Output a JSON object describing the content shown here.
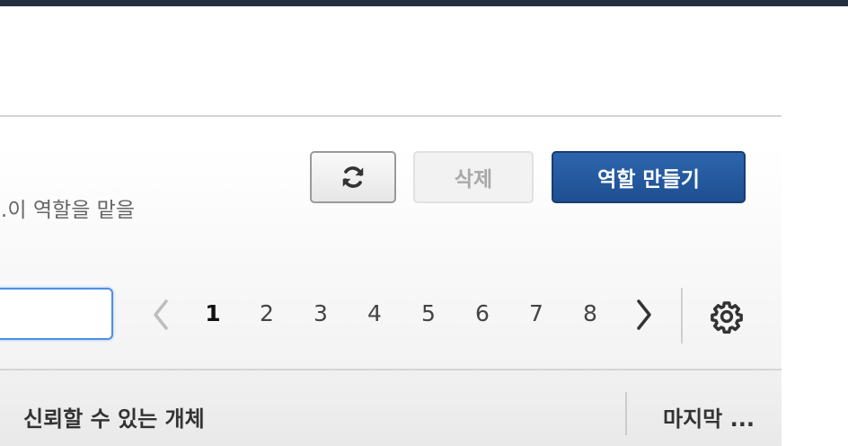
{
  "description": {
    "text": "…이 역할을 맡을"
  },
  "toolbar": {
    "refresh_icon": "refresh-icon",
    "delete_label": "삭제",
    "create_label": "역할 만들기"
  },
  "search": {
    "value": "",
    "placeholder": ""
  },
  "pagination": {
    "prev_icon": "chevron-left-icon",
    "next_icon": "chevron-right-icon",
    "pages": [
      "1",
      "2",
      "3",
      "4",
      "5",
      "6",
      "7",
      "8"
    ],
    "current": "1"
  },
  "settings_icon": "gear-icon",
  "table": {
    "columns": [
      "신뢰할 수 있는 개체",
      "마지막 ..."
    ]
  }
}
